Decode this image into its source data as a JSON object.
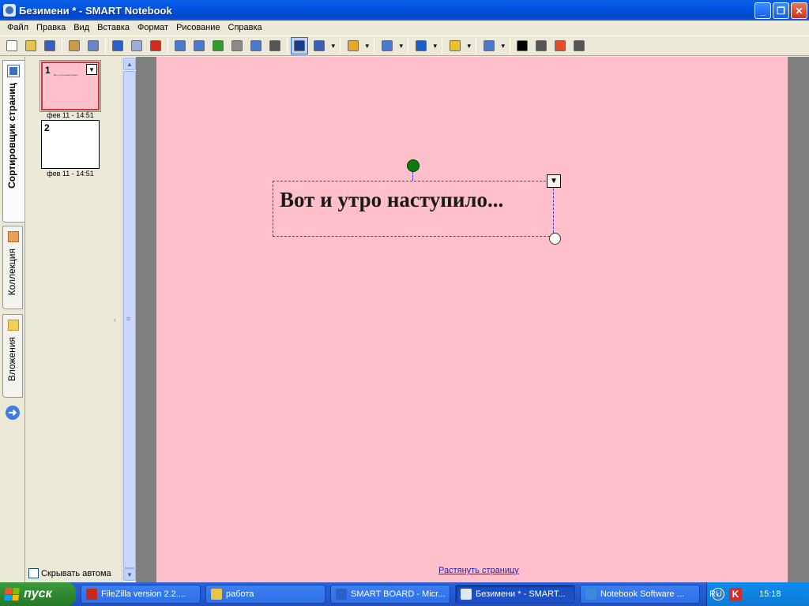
{
  "window": {
    "title": "Безимени * - SMART Notebook"
  },
  "menu": [
    "Файл",
    "Правка",
    "Вид",
    "Вставка",
    "Формат",
    "Рисование",
    "Справка"
  ],
  "toolbar": {
    "buttons": [
      {
        "name": "new-page",
        "icon": "new-document-icon",
        "color": "#ffffff"
      },
      {
        "name": "open",
        "icon": "folder-open-icon",
        "color": "#e8c44a"
      },
      {
        "name": "save",
        "icon": "floppy-disk-icon",
        "color": "#3a5fb8"
      },
      {
        "name": "paste",
        "icon": "clipboard-icon",
        "color": "#c89a4a"
      },
      {
        "name": "screen-shade",
        "icon": "magic-wand-icon",
        "color": "#6a86c8"
      },
      {
        "name": "undo",
        "icon": "undo-icon",
        "color": "#2a5fc8"
      },
      {
        "name": "redo",
        "icon": "redo-icon",
        "color": "#9aaed8"
      },
      {
        "name": "delete",
        "icon": "red-x-icon",
        "color": "#d42a1a"
      },
      {
        "name": "prev-page",
        "icon": "previous-page-icon",
        "color": "#4a7ad0"
      },
      {
        "name": "next-page",
        "icon": "next-page-icon",
        "color": "#4a7ad0"
      },
      {
        "name": "add-page",
        "icon": "add-page-icon",
        "color": "#2aa02a"
      },
      {
        "name": "table",
        "icon": "table-icon",
        "color": "#8a8a8a"
      },
      {
        "name": "full-screen",
        "icon": "full-screen-icon",
        "color": "#4a7ad0"
      },
      {
        "name": "camera",
        "icon": "camera-icon",
        "color": "#555555"
      },
      {
        "name": "select",
        "icon": "select-arrow-icon",
        "color": "#1a3a8a",
        "active": true
      },
      {
        "name": "pen",
        "icon": "pen-icon",
        "color": "#3a5fb8",
        "dropdown": true
      },
      {
        "name": "creative-pen",
        "icon": "creative-pen-icon",
        "color": "#e8a82a",
        "dropdown": true
      },
      {
        "name": "eraser",
        "icon": "eraser-icon",
        "color": "#4a7ad0",
        "dropdown": true
      },
      {
        "name": "line",
        "icon": "line-icon",
        "color": "#1a5fc8",
        "dropdown": true
      },
      {
        "name": "shapes",
        "icon": "shapes-icon",
        "color": "#e8c42a",
        "dropdown": true
      },
      {
        "name": "fill",
        "icon": "image-icon",
        "color": "#4a7ad0",
        "dropdown": true
      },
      {
        "name": "line-color",
        "icon": "color-square-icon",
        "color": "#000000"
      },
      {
        "name": "line-style",
        "icon": "line-style-icon",
        "color": "#555555"
      },
      {
        "name": "fill-effects",
        "icon": "color-palette-icon",
        "color": "#e84a2a"
      },
      {
        "name": "properties",
        "icon": "properties-icon",
        "color": "#555555"
      }
    ]
  },
  "side_tabs": [
    {
      "label": "Сортировщик страниц",
      "icon": "page-sorter-icon",
      "active": true
    },
    {
      "label": "Коллекция",
      "icon": "gallery-icon",
      "active": false
    },
    {
      "label": "Вложения",
      "icon": "attachments-icon",
      "active": false
    }
  ],
  "pages": [
    {
      "number": "1",
      "date": "фев 11 - 14:51",
      "selected": true,
      "color": "#ffc0cb",
      "mini_text": "Вот и утро наступило..."
    },
    {
      "number": "2",
      "date": "фев 11 - 14:51",
      "selected": false,
      "color": "#ffffff"
    }
  ],
  "sorter": {
    "auto_hide_label": "Скрывать автома"
  },
  "canvas": {
    "background": "#ffc0cb",
    "text_object": "Вот и утро наступило...",
    "stretch_link": "Растянуть страницу"
  },
  "taskbar": {
    "start_label": "пуск",
    "tasks": [
      {
        "label": "FileZilla version 2.2....",
        "icon": "filezilla-icon",
        "color": "#c8281a",
        "active": false
      },
      {
        "label": "работа",
        "icon": "folder-icon",
        "color": "#e8c44a",
        "active": false
      },
      {
        "label": "SMART BOARD - Micr...",
        "icon": "word-icon",
        "color": "#2a5fc8",
        "active": false
      },
      {
        "label": "Безимени * - SMART...",
        "icon": "smart-notebook-icon",
        "color": "#dfe8f5",
        "active": true
      },
      {
        "label": "Notebook Software ...",
        "icon": "internet-explorer-icon",
        "color": "#3a8ad8",
        "active": false
      }
    ],
    "language": "RU",
    "clock": "15:18"
  }
}
